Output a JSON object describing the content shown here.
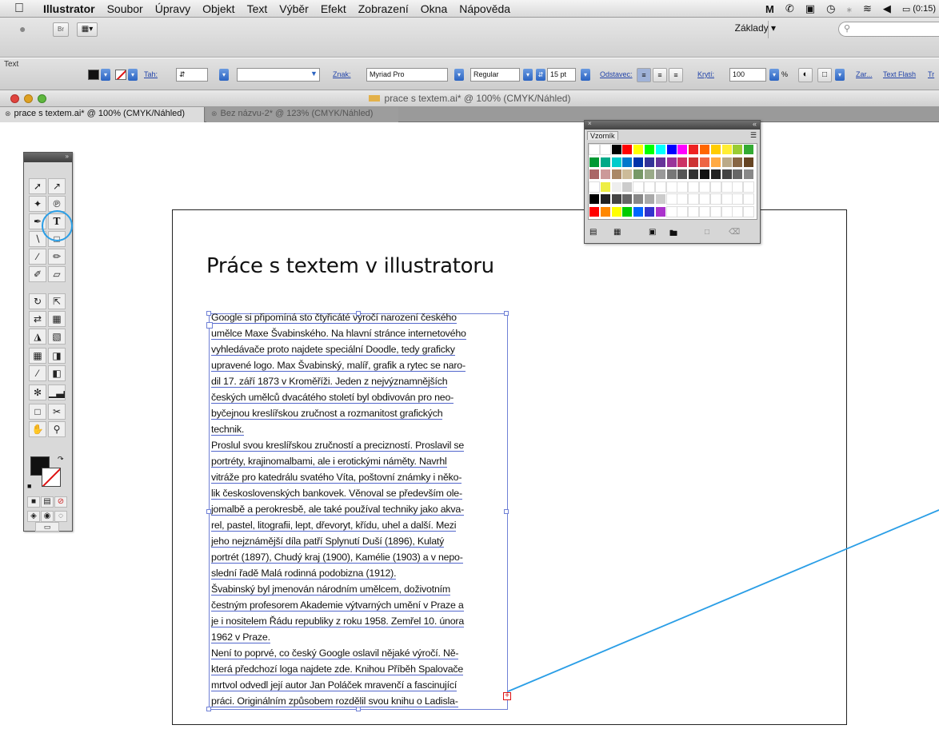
{
  "menubar": {
    "app_name": "Illustrator",
    "items": [
      "Soubor",
      "Úpravy",
      "Objekt",
      "Text",
      "Výběr",
      "Efekt",
      "Zobrazení",
      "Okna",
      "Nápověda"
    ],
    "battery": "(0:15)"
  },
  "appbar": {
    "bridge_label": "Br",
    "workspace_label": "Základy ▾"
  },
  "controlbar": {
    "tool_name": "Text",
    "stroke_label": "Tah:",
    "char_label": "Znak:",
    "font_family": "Myriad Pro",
    "font_style": "Regular",
    "font_size": "15 pt",
    "paragraph_label": "Odstavec:",
    "opacity_label": "Krytí:",
    "opacity_value": "100",
    "opacity_unit": "%",
    "link_transform": "Zar...",
    "link_textflash": "Text Flash",
    "link_tr": "Tr"
  },
  "window": {
    "title": "prace s textem.ai* @ 100% (CMYK/Náhled)"
  },
  "tabs": [
    {
      "label": "prace s textem.ai* @ 100% (CMYK/Náhled)",
      "active": true
    },
    {
      "label": "Bez názvu-2* @ 123% (CMYK/Náhled)",
      "active": false
    }
  ],
  "swatch_panel": {
    "tab": "Vzorník"
  },
  "document": {
    "heading": "Práce s textem v illustratoru",
    "lines": [
      "Google si připomíná sto čtyřicáté výročí narození českého",
      "umělce Maxe Švabinského. Na hlavní stránce internetového",
      "vyhledávače proto najdete speciální Doodle, tedy graficky",
      "upravené logo. Max Švabinský, malíř, grafik a rytec se naro-",
      "dil 17. září 1873 v Kroměříži. Jeden z nejvýznamnějších",
      "českých umělců dvacátého století byl obdivován pro neo-",
      "byčejnou kreslířskou zručnost a rozmanitost grafických",
      "technik.",
      "Proslul svou kreslířskou zručností a precizností. Proslavil se",
      "portréty, krajinomalbami, ale i erotickými náměty. Navrhl",
      "vitráže pro katedrálu svatého Víta, poštovní známky i něko-",
      "lik československých bankovek. Věnoval se především ole-",
      "jomalbě a perokresbě, ale také používal techniky jako akva-",
      "rel, pastel, litografii, lept, dřevoryt, křídu, uhel a další. Mezi",
      "jeho nejznámější díla patří Splynutí Duší (1896), Kulatý",
      "portrét (1897), Chudý kraj (1900), Kamélie (1903) a v nepo-",
      "slední řadě Malá rodinná podobizna (1912).",
      "Švabinský byl jmenován národním umělcem, doživotním",
      "čestným profesorem Akademie výtvarných umění v Praze a",
      "je i nositelem Řádu republiky z roku 1958. Zemřel 10. února",
      "1962 v Praze.",
      "Není to poprvé, co český Google oslavil nějaké výročí. Ně-",
      "která předchozí loga najdete zde. Knihou Příběh Spalovače",
      "mrtvol odvedl její autor Jan Poláček mravenčí a fascinující",
      "práci. Originálním způsobem rozdělil svou knihu o Ladisla-"
    ]
  },
  "colors": {
    "accent_circle": "#2a9ee6",
    "frame": "#6f80d6",
    "overflow": "#dd1111"
  }
}
